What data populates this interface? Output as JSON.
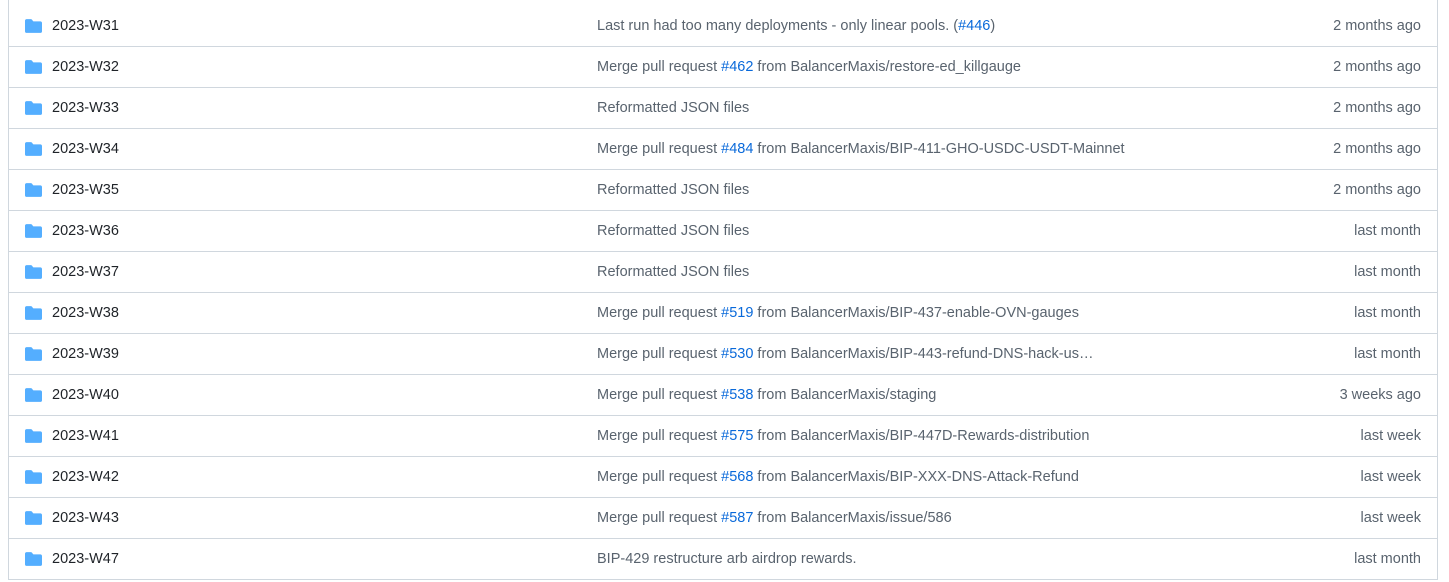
{
  "colors": {
    "folder": "#54aeff",
    "link": "#0969da",
    "muted_text": "#59636e",
    "name_text": "#1f2328",
    "border": "#d0d7de"
  },
  "rows": [
    {
      "name": "2023-W31",
      "icon": "folder-icon",
      "msg_prefix": "Last run had too many deployments - only linear pools. (",
      "link": "#446",
      "msg_suffix": ")",
      "age": "2 months ago"
    },
    {
      "name": "2023-W32",
      "icon": "folder-icon",
      "msg_prefix": "Merge pull request ",
      "link": "#462",
      "msg_suffix": " from BalancerMaxis/restore-ed_killgauge",
      "age": "2 months ago"
    },
    {
      "name": "2023-W33",
      "icon": "folder-icon",
      "msg_prefix": "Reformatted JSON files",
      "link": "",
      "msg_suffix": "",
      "age": "2 months ago"
    },
    {
      "name": "2023-W34",
      "icon": "folder-icon",
      "msg_prefix": "Merge pull request ",
      "link": "#484",
      "msg_suffix": " from BalancerMaxis/BIP-411-GHO-USDC-USDT-Mainnet",
      "age": "2 months ago"
    },
    {
      "name": "2023-W35",
      "icon": "folder-icon",
      "msg_prefix": "Reformatted JSON files",
      "link": "",
      "msg_suffix": "",
      "age": "2 months ago"
    },
    {
      "name": "2023-W36",
      "icon": "folder-icon",
      "msg_prefix": "Reformatted JSON files",
      "link": "",
      "msg_suffix": "",
      "age": "last month"
    },
    {
      "name": "2023-W37",
      "icon": "folder-icon",
      "msg_prefix": "Reformatted JSON files",
      "link": "",
      "msg_suffix": "",
      "age": "last month"
    },
    {
      "name": "2023-W38",
      "icon": "folder-icon",
      "msg_prefix": "Merge pull request ",
      "link": "#519",
      "msg_suffix": " from BalancerMaxis/BIP-437-enable-OVN-gauges",
      "age": "last month"
    },
    {
      "name": "2023-W39",
      "icon": "folder-icon",
      "msg_prefix": "Merge pull request ",
      "link": "#530",
      "msg_suffix": " from BalancerMaxis/BIP-443-refund-DNS-hack-us…",
      "age": "last month"
    },
    {
      "name": "2023-W40",
      "icon": "folder-icon",
      "msg_prefix": "Merge pull request ",
      "link": "#538",
      "msg_suffix": " from BalancerMaxis/staging",
      "age": "3 weeks ago"
    },
    {
      "name": "2023-W41",
      "icon": "folder-icon",
      "msg_prefix": "Merge pull request ",
      "link": "#575",
      "msg_suffix": " from BalancerMaxis/BIP-447D-Rewards-distribution",
      "age": "last week"
    },
    {
      "name": "2023-W42",
      "icon": "folder-icon",
      "msg_prefix": "Merge pull request ",
      "link": "#568",
      "msg_suffix": " from BalancerMaxis/BIP-XXX-DNS-Attack-Refund",
      "age": "last week"
    },
    {
      "name": "2023-W43",
      "icon": "folder-icon",
      "msg_prefix": "Merge pull request ",
      "link": "#587",
      "msg_suffix": " from BalancerMaxis/issue/586",
      "age": "last week"
    },
    {
      "name": "2023-W47",
      "icon": "folder-icon",
      "msg_prefix": "BIP-429 restructure arb airdrop rewards.",
      "link": "",
      "msg_suffix": "",
      "age": "last month"
    }
  ]
}
